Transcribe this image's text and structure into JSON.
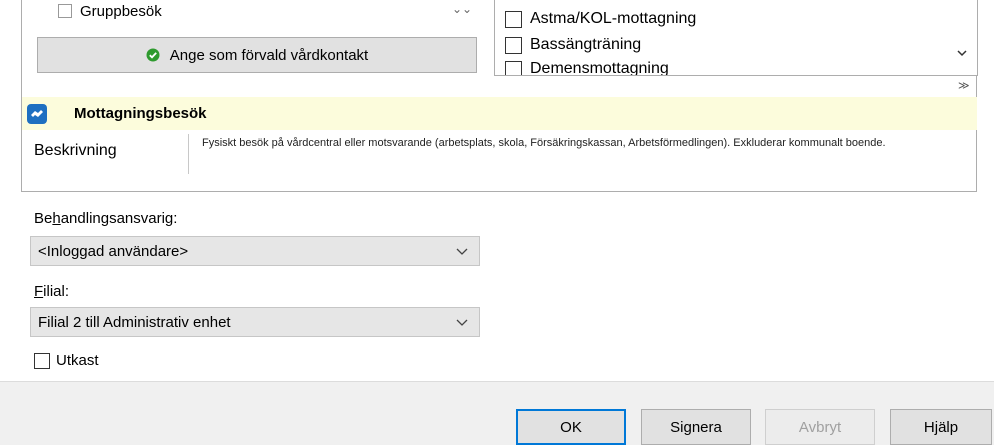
{
  "top": {
    "partial_left_item": "Gruppbesök",
    "default_button": "Ange som förvald vårdkontakt",
    "right_list": [
      "Astma/KOL-mottagning",
      "Bassängträning",
      "Demensmottagning"
    ]
  },
  "visit": {
    "title": "Mottagningsbesök",
    "description_label": "Beskrivning",
    "description_text": "Fysiskt besök på vårdcentral eller motsvarande (arbetsplats, skola, Försäkringskassan, Arbetsförmedlingen). Exkluderar kommunalt boende."
  },
  "fields": {
    "responsible_label_pre": "Be",
    "responsible_label_key": "h",
    "responsible_label_post": "andlingsansvarig:",
    "responsible_value": "<Inloggad användare>",
    "branch_label_key": "F",
    "branch_label_post": "ilial:",
    "branch_value": "Filial 2 till Administrativ enhet",
    "draft_label": "Utkast"
  },
  "buttons": {
    "ok": "OK",
    "sign": "Signera",
    "cancel": "Avbryt",
    "help": "Hjälp"
  },
  "colors": {
    "accent": "#0078d7",
    "header_band": "#fcfcdc",
    "ok_icon": "#2e9a2e"
  }
}
